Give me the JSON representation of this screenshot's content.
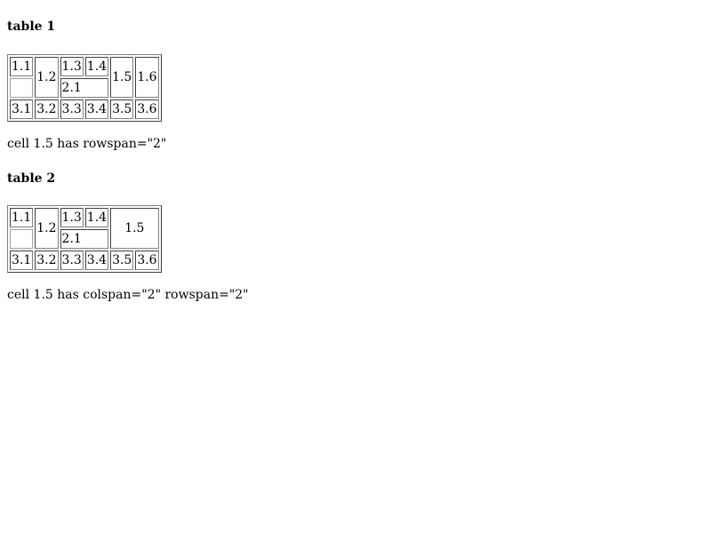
{
  "table1": {
    "heading": "table 1",
    "row1": [
      "1.1",
      "1.2",
      "1.3",
      "1.4",
      "1.5",
      "1.6"
    ],
    "row2": [
      "2.1"
    ],
    "row3": [
      "3.1",
      "3.2",
      "3.3",
      "3.4",
      "3.5",
      "3.6"
    ],
    "caption": "cell 1.5 has rowspan=\"2\""
  },
  "table2": {
    "heading": "table 2",
    "row1": [
      "1.1",
      "1.2",
      "1.3",
      "1.4",
      "1.5"
    ],
    "row2": [
      "2.1"
    ],
    "row3": [
      "3.1",
      "3.2",
      "3.3",
      "3.4",
      "3.5",
      "3.6"
    ],
    "caption": "cell 1.5 has colspan=\"2\" rowspan=\"2\""
  }
}
